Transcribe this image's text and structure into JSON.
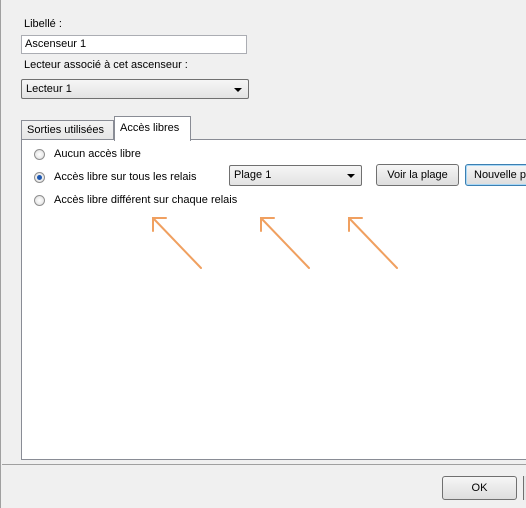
{
  "form": {
    "libelle_label": "Libellé :",
    "libelle_value": "Ascenseur 1",
    "lecteur_label": "Lecteur associé à cet ascenseur :",
    "lecteur_value": "Lecteur 1"
  },
  "tabs": [
    {
      "label": "Sorties utilisées",
      "active": false
    },
    {
      "label": "Accès libres",
      "active": true
    }
  ],
  "acces_libres": {
    "options": [
      {
        "label": "Aucun accès libre",
        "checked": false
      },
      {
        "label": "Accès libre sur tous les relais",
        "checked": true
      },
      {
        "label": "Accès libre différent sur chaque relais",
        "checked": false
      }
    ],
    "plage_value": "Plage 1",
    "voir_plage_label": "Voir la plage",
    "nouvelle_plage_label": "Nouvelle p"
  },
  "footer": {
    "ok_label": "OK"
  },
  "colors": {
    "annotation_arrow": "#f0a060",
    "dialog_bg": "#f0f0f0",
    "panel_bg": "#ffffff"
  },
  "icons": [
    "dropdown-arrow-icon",
    "annotation-arrow-icon"
  ]
}
